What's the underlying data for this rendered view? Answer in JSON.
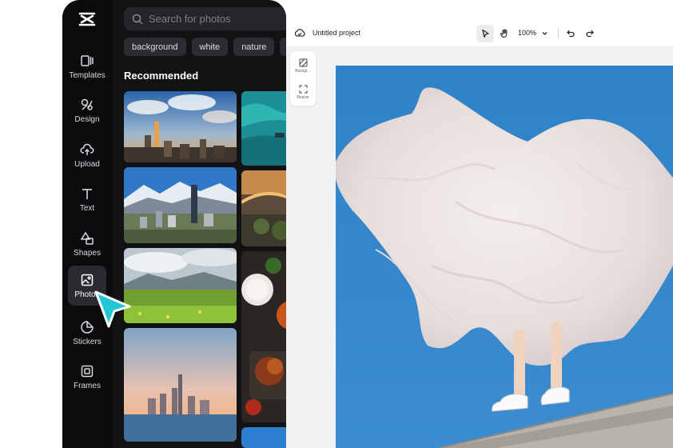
{
  "sidebar": {
    "items": [
      {
        "label": "Templates",
        "icon": "templates-icon"
      },
      {
        "label": "Design",
        "icon": "design-icon"
      },
      {
        "label": "Upload",
        "icon": "upload-cloud-icon"
      },
      {
        "label": "Text",
        "icon": "text-icon"
      },
      {
        "label": "Shapes",
        "icon": "shapes-icon"
      },
      {
        "label": "Photos",
        "icon": "photo-icon",
        "active": true
      },
      {
        "label": "Stickers",
        "icon": "sticker-icon"
      },
      {
        "label": "Frames",
        "icon": "frame-icon"
      }
    ]
  },
  "search": {
    "placeholder": "Search for photos"
  },
  "chips": [
    "background",
    "white",
    "nature"
  ],
  "section_title": "Recommended",
  "topbar": {
    "project_title": "Untitled project",
    "zoom": "100%"
  },
  "side_tools": [
    {
      "label": "Backgr...",
      "icon": "background-icon"
    },
    {
      "label": "Resize",
      "icon": "resize-icon"
    }
  ],
  "colors": {
    "accent_cursor": "#1ec8d6",
    "panel": "#121214",
    "canvas": "#f1f2f4",
    "sky": "#2f7fc1"
  }
}
